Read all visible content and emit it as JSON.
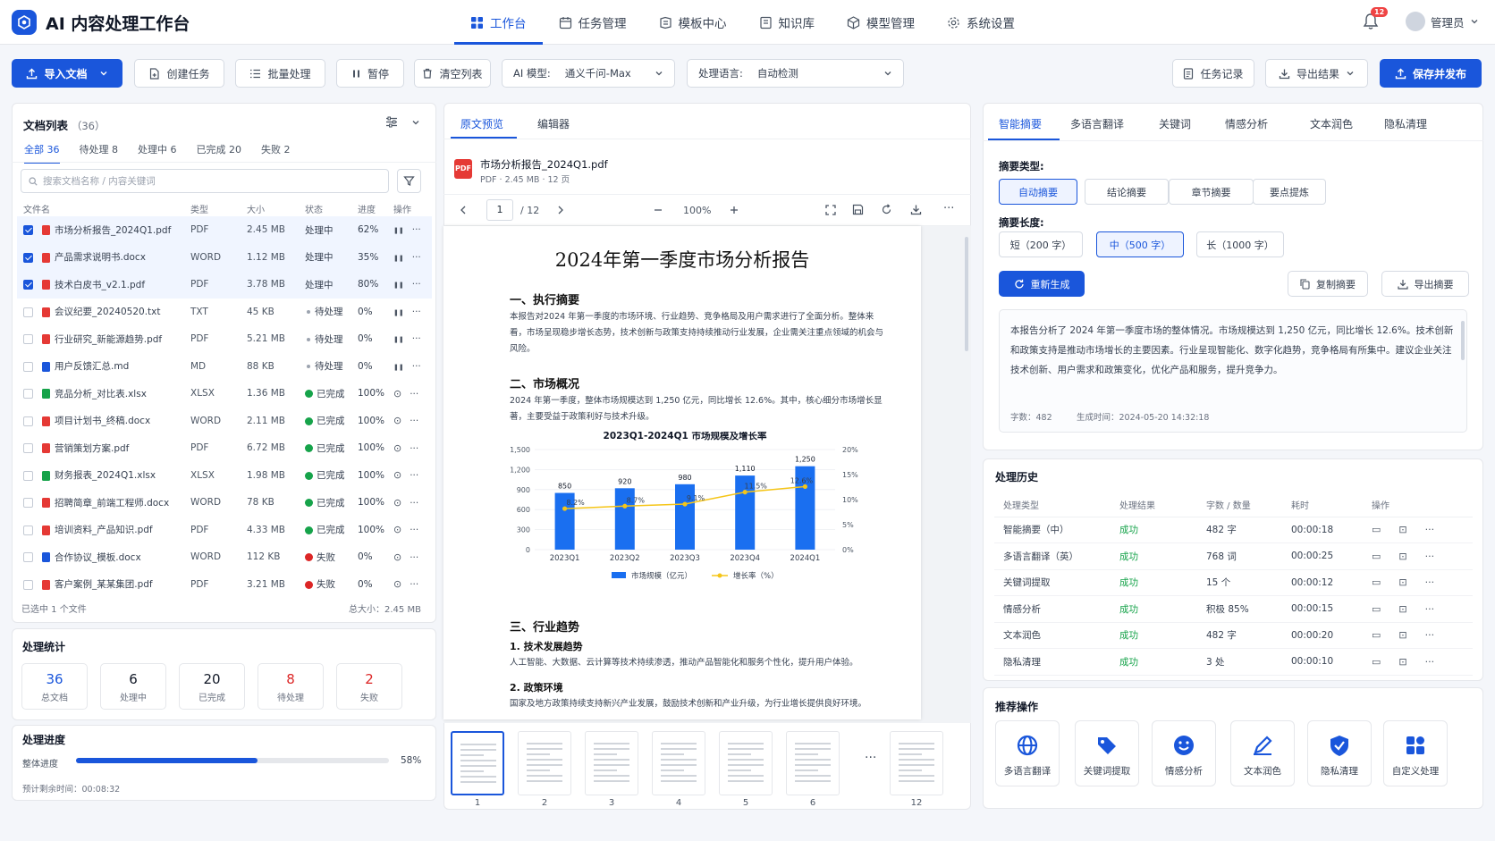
{
  "app": {
    "title": "AI 内容处理工作台",
    "notifications": "12",
    "user": "管理员"
  },
  "nav": [
    {
      "label": "工作台",
      "icon": "grid-icon"
    },
    {
      "label": "任务管理",
      "icon": "calendar-icon"
    },
    {
      "label": "模板中心",
      "icon": "template-icon"
    },
    {
      "label": "知识库",
      "icon": "book-icon"
    },
    {
      "label": "模型管理",
      "icon": "cube-icon"
    },
    {
      "label": "系统设置",
      "icon": "gear-icon"
    }
  ],
  "toolbar": {
    "import": "导入文档",
    "create": "创建任务",
    "batch": "批量处理",
    "pause": "暂停",
    "clear": "清空列表",
    "model_label": "AI 模型:",
    "model_value": "通义千问-Max",
    "lang_label": "处理语言:",
    "lang_value": "自动检测",
    "records": "任务记录",
    "export": "导出结果",
    "publish": "保存并发布"
  },
  "doclist": {
    "title": "文档列表",
    "count": "（36）",
    "tabs": [
      "全部 36",
      "待处理 8",
      "处理中 6",
      "已完成 20",
      "失败 2"
    ],
    "search_placeholder": "搜索文档名称 / 内容关键词",
    "columns": [
      "文件名",
      "类型",
      "大小",
      "状态",
      "进度",
      "操作"
    ],
    "rows": [
      {
        "name": "市场分析报告_2024Q1.pdf",
        "type": "PDF",
        "size": "2.45 MB",
        "status": "处理中",
        "progress": "62%",
        "state": "proc",
        "checked": true,
        "color": "#e53935"
      },
      {
        "name": "产品需求说明书.docx",
        "type": "WORD",
        "size": "1.12 MB",
        "status": "处理中",
        "progress": "35%",
        "state": "proc",
        "checked": true,
        "color": "#e53935"
      },
      {
        "name": "技术白皮书_v2.1.pdf",
        "type": "PDF",
        "size": "3.78 MB",
        "status": "处理中",
        "progress": "80%",
        "state": "proc",
        "checked": true,
        "color": "#e53935"
      },
      {
        "name": "会议纪要_20240520.txt",
        "type": "TXT",
        "size": "45 KB",
        "status": "待处理",
        "progress": "0%",
        "state": "wait",
        "checked": false,
        "color": "#e53935"
      },
      {
        "name": "行业研究_新能源趋势.pdf",
        "type": "PDF",
        "size": "5.21 MB",
        "status": "待处理",
        "progress": "0%",
        "state": "wait",
        "checked": false,
        "color": "#e53935"
      },
      {
        "name": "用户反馈汇总.md",
        "type": "MD",
        "size": "88 KB",
        "status": "待处理",
        "progress": "0%",
        "state": "wait",
        "checked": false,
        "color": "#1a56db"
      },
      {
        "name": "竞品分析_对比表.xlsx",
        "type": "XLSX",
        "size": "1.36 MB",
        "status": "已完成",
        "progress": "100%",
        "state": "done",
        "checked": false,
        "color": "#16a34a"
      },
      {
        "name": "项目计划书_终稿.docx",
        "type": "WORD",
        "size": "2.11 MB",
        "status": "已完成",
        "progress": "100%",
        "state": "done",
        "checked": false,
        "color": "#e53935"
      },
      {
        "name": "营销策划方案.pdf",
        "type": "PDF",
        "size": "6.72 MB",
        "status": "已完成",
        "progress": "100%",
        "state": "done",
        "checked": false,
        "color": "#e53935"
      },
      {
        "name": "财务报表_2024Q1.xlsx",
        "type": "XLSX",
        "size": "1.98 MB",
        "status": "已完成",
        "progress": "100%",
        "state": "done",
        "checked": false,
        "color": "#16a34a"
      },
      {
        "name": "招聘简章_前端工程师.docx",
        "type": "WORD",
        "size": "78 KB",
        "status": "已完成",
        "progress": "100%",
        "state": "done",
        "checked": false,
        "color": "#e53935"
      },
      {
        "name": "培训资料_产品知识.pdf",
        "type": "PDF",
        "size": "4.33 MB",
        "status": "已完成",
        "progress": "100%",
        "state": "done",
        "checked": false,
        "color": "#e53935"
      },
      {
        "name": "合作协议_模板.docx",
        "type": "WORD",
        "size": "112 KB",
        "status": "失败",
        "progress": "0%",
        "state": "fail",
        "checked": false,
        "color": "#1a56db"
      },
      {
        "name": "客户案例_某某集团.pdf",
        "type": "PDF",
        "size": "3.21 MB",
        "status": "失败",
        "progress": "0%",
        "state": "fail",
        "checked": false,
        "color": "#e53935"
      }
    ],
    "selected": "已选中  1 个文件",
    "total": "总大小：2.45 MB"
  },
  "stats": {
    "title": "处理统计",
    "items": [
      {
        "n": "36",
        "l": "总文档",
        "c": "#1a56db"
      },
      {
        "n": "6",
        "l": "处理中",
        "c": "#111827"
      },
      {
        "n": "20",
        "l": "已完成",
        "c": "#111827"
      },
      {
        "n": "8",
        "l": "待处理",
        "c": "#dc2626"
      },
      {
        "n": "2",
        "l": "失败",
        "c": "#dc2626"
      }
    ]
  },
  "progress": {
    "title": "处理进度",
    "label": "整体进度",
    "value": 0.58,
    "text": "58%",
    "remaining": "预计剩余时间：00:08:32"
  },
  "preview": {
    "tabs": [
      "原文预览",
      "编辑器"
    ],
    "file": "市场分析报告_2024Q1.pdf",
    "meta": "PDF · 2.45 MB · 12 页",
    "page": "1",
    "pages": "/ 12",
    "zoom": "100%",
    "doc_title": "2024年第一季度市场分析报告",
    "s1": "一、执行摘要",
    "p1": "本报告对2024 年第一季度的市场环境、行业趋势、竞争格局及用户需求进行了全面分析。整体来看，市场呈现稳步增长态势，技术创新与政策支持持续推动行业发展，企业需关注重点领域的机会与风险。",
    "s2": "二、市场概况",
    "p2": "2024 年第一季度，整体市场规模达到 1,250 亿元，同比增长 12.6%。其中，核心细分市场增长显著，主要受益于政策利好与技术升级。",
    "s3": "三、行业趋势",
    "s3a": "1. 技术发展趋势",
    "p3a": "人工智能、大数据、云计算等技术持续渗透，推动产品智能化和服务个性化，提升用户体验。",
    "s3b": "2. 政策环境",
    "p3b": "国家及地方政策持续支持新兴产业发展，鼓励技术创新和产业升级，为行业增长提供良好环境。",
    "thumbs": [
      "1",
      "2",
      "3",
      "4",
      "5",
      "6",
      "12"
    ],
    "more": "···"
  },
  "chart_data": {
    "type": "bar",
    "title": "2023Q1-2024Q1  市场规模及增长率",
    "categories": [
      "2023Q1",
      "2023Q2",
      "2023Q3",
      "2023Q4",
      "2024Q1"
    ],
    "series": [
      {
        "name": "市场规模（亿元）",
        "type": "bar",
        "values": [
          850,
          920,
          980,
          1110,
          1250
        ],
        "labels": [
          "850",
          "920",
          "980",
          "1,110",
          "1,250"
        ],
        "color": "#1a6ff0"
      },
      {
        "name": "增长率（%）",
        "type": "line",
        "values": [
          8.2,
          8.7,
          9.1,
          11.5,
          12.6
        ],
        "labels": [
          "8.2%",
          "8.7%",
          "9.1%",
          "11.5%",
          "12.6%"
        ],
        "color": "#f5c518"
      }
    ],
    "yticks_left": [
      "1,500",
      "1,200",
      "900",
      "600",
      "300",
      "0"
    ],
    "ylim_left": [
      0,
      1500
    ],
    "yticks_right": [
      "20%",
      "15%",
      "10%",
      "5%",
      "0%"
    ],
    "ylim_right": [
      0,
      20
    ],
    "legend": "bottom"
  },
  "right": {
    "tabs": [
      "智能摘要",
      "多语言翻译",
      "关键词",
      "情感分析",
      "文本润色",
      "隐私清理"
    ],
    "type_label": "摘要类型:",
    "types": [
      "自动摘要",
      "结论摘要",
      "章节摘要",
      "要点提炼"
    ],
    "len_label": "摘要长度:",
    "lens": [
      "短（200 字）",
      "中（500 字）",
      "长（1000 字）"
    ],
    "regen": "重新生成",
    "copy": "复制摘要",
    "export": "导出摘要",
    "summary": "本报告分析了 2024 年第一季度市场的整体情况。市场规模达到 1,250 亿元，同比增长 12.6%。技术创新和政策支持是推动市场增长的主要因素。行业呈现智能化、数字化趋势，竞争格局有所集中。建议企业关注技术创新、用户需求和政策变化，优化产品和服务，提升竞争力。",
    "words": "字数：482",
    "time": "生成时间：2024-05-20 14:32:18"
  },
  "history": {
    "title": "处理历史",
    "columns": [
      "处理类型",
      "处理结果",
      "字数 / 数量",
      "耗时",
      "操作"
    ],
    "rows": [
      {
        "t": "智能摘要（中）",
        "r": "成功",
        "c": "482 字",
        "d": "00:00:18"
      },
      {
        "t": "多语言翻译（英）",
        "r": "成功",
        "c": "768 词",
        "d": "00:00:25"
      },
      {
        "t": "关键词提取",
        "r": "成功",
        "c": "15 个",
        "d": "00:00:12"
      },
      {
        "t": "情感分析",
        "r": "成功",
        "c": "积极 85%",
        "d": "00:00:15"
      },
      {
        "t": "文本润色",
        "r": "成功",
        "c": "482 字",
        "d": "00:00:20"
      },
      {
        "t": "隐私清理",
        "r": "成功",
        "c": "3 处",
        "d": "00:00:10"
      }
    ]
  },
  "recommend": {
    "title": "推荐操作",
    "items": [
      {
        "l": "多语言翻译",
        "icon": "globe-icon"
      },
      {
        "l": "关键词提取",
        "icon": "tag-icon"
      },
      {
        "l": "情感分析",
        "icon": "smile-icon"
      },
      {
        "l": "文本润色",
        "icon": "pen-icon"
      },
      {
        "l": "隐私清理",
        "icon": "shield-icon"
      },
      {
        "l": "自定义处理",
        "icon": "apps-icon"
      }
    ]
  }
}
